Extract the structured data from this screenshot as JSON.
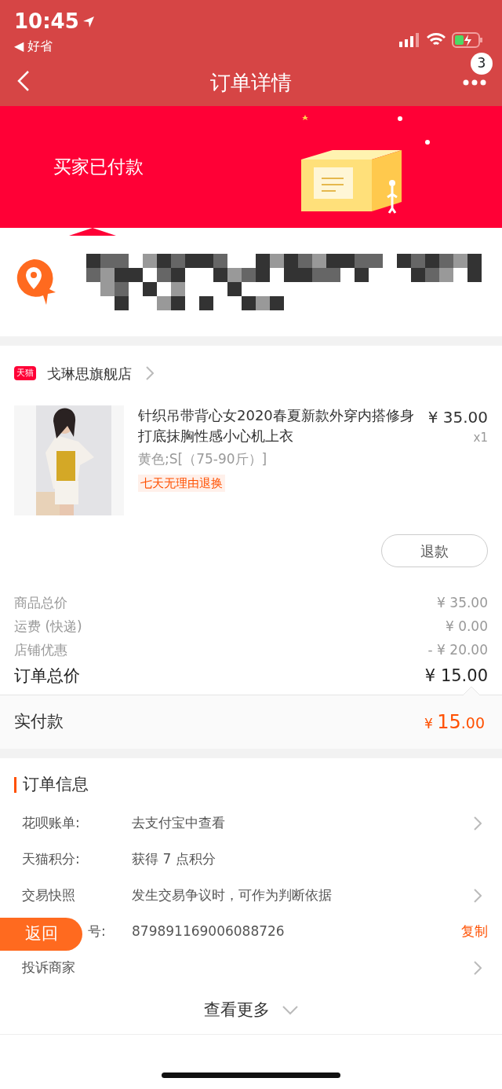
{
  "status_bar": {
    "time": "10:45",
    "back_app": "◀ 好省"
  },
  "nav": {
    "title": "订单详情",
    "badge": "3"
  },
  "banner": {
    "status": "买家已付款"
  },
  "shop": {
    "tag": "天猫",
    "name": "戈琳思旗舰店"
  },
  "product": {
    "title": "针织吊带背心女2020春夏新款外穿内搭修身打底抹胸性感小心机上衣",
    "sku": "黄色;S[（75-90斤）]",
    "service_tag": "七天无理由退换",
    "price": "¥ 35.00",
    "quantity": "x1",
    "refund_button": "退款"
  },
  "price_rows": [
    {
      "label": "商品总价",
      "value": "¥ 35.00",
      "kind": "minor"
    },
    {
      "label": "运费 (快递)",
      "value": "¥ 0.00",
      "kind": "minor"
    },
    {
      "label": "店铺优惠",
      "value": "- ¥ 20.00",
      "kind": "minor"
    },
    {
      "label": "订单总价",
      "value": "¥ 15.00",
      "kind": "total"
    }
  ],
  "paid": {
    "label": "实付款",
    "currency": "¥",
    "integer": "15",
    "decimal": ".00"
  },
  "order_info": {
    "heading": "订单信息",
    "rows": [
      {
        "label": "花呗账单:",
        "value": "去支付宝中查看",
        "kind": "link"
      },
      {
        "label": "天猫积分:",
        "value": "获得 7 点积分",
        "kind": "plain"
      },
      {
        "label": "交易快照",
        "value": "发生交易争议时，可作为判断依据",
        "kind": "link"
      },
      {
        "label": "号:",
        "value": "879891169006088726",
        "kind": "copy",
        "action_text": "复制"
      },
      {
        "label": "投诉商家",
        "kind": "link"
      }
    ],
    "more": "查看更多"
  },
  "float_button": "返回"
}
